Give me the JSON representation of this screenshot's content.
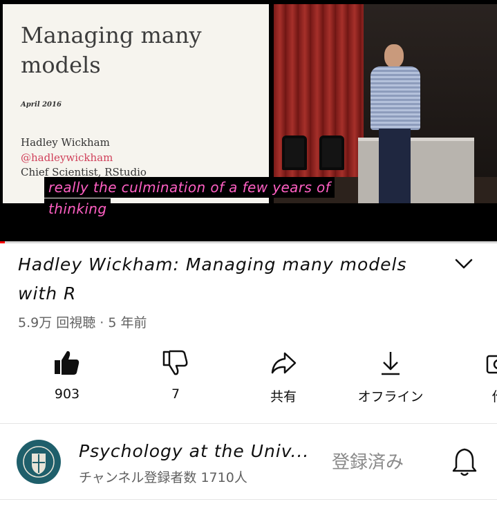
{
  "video": {
    "slide": {
      "title": "Managing many models",
      "date": "April 2016",
      "name": "Hadley Wickham",
      "handle": "@hadleywickham",
      "role": "Chief Scientist, RStudio"
    },
    "captions": [
      "really the culmination of a few years of",
      "thinking"
    ],
    "progress": 0.01
  },
  "info": {
    "title": "Hadley Wickham: Managing many models with R",
    "meta": "5.9万 回視聴 · 5 年前"
  },
  "actions": {
    "like": "903",
    "dislike": "7",
    "share": "共有",
    "offline": "オフライン",
    "create": "作"
  },
  "channel": {
    "name": "Psychology at the Univ...",
    "subscribers": "チャンネル登録者数 1710人",
    "subscribed_label": "登録済み"
  },
  "colors": {
    "caption": "#ff5fc3",
    "progress": "#ff0000",
    "secondary_text": "#606060"
  },
  "icons": [
    "thumbs-up-icon",
    "thumbs-down-icon",
    "share-icon",
    "download-icon",
    "create-clip-icon",
    "chevron-down-icon",
    "bell-icon"
  ]
}
